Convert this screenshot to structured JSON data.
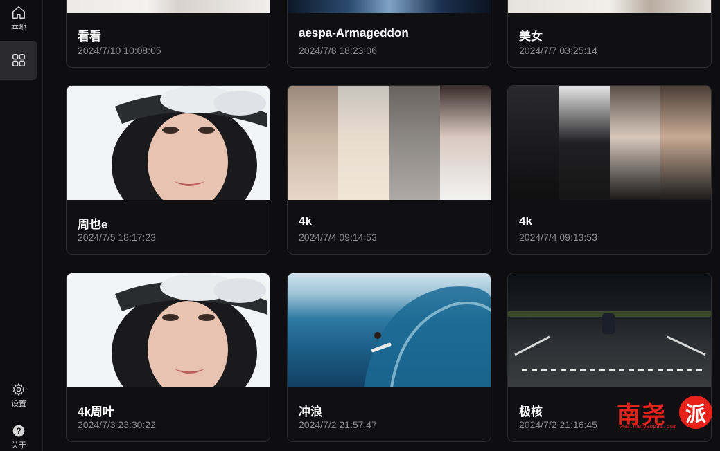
{
  "sidebar": {
    "items": [
      {
        "label": "本地",
        "icon": "home-icon"
      },
      {
        "label": "",
        "icon": "grid-icon"
      },
      {
        "label": "设置",
        "icon": "gear-icon"
      },
      {
        "label": "关于",
        "icon": "help-icon"
      }
    ]
  },
  "videos": [
    {
      "title": "看看",
      "date": "2024/7/10 10:08:05"
    },
    {
      "title": "aespa-Armageddon",
      "date": "2024/7/8 18:23:06"
    },
    {
      "title": "美女",
      "date": "2024/7/7 03:25:14"
    },
    {
      "title": "周也e",
      "date": "2024/7/5 18:17:23"
    },
    {
      "title": "4k",
      "date": "2024/7/4 09:14:53"
    },
    {
      "title": "4k",
      "date": "2024/7/4 09:13:53"
    },
    {
      "title": "4k周叶",
      "date": "2024/7/3 23:30:22"
    },
    {
      "title": "冲浪",
      "date": "2024/7/2 21:57:47"
    },
    {
      "title": "极核",
      "date": "2024/7/2 21:16:45"
    }
  ],
  "watermark": {
    "text": "南尧",
    "circle": "派",
    "url": "www.nanyaopai.com"
  },
  "colors": {
    "background": "#0e0e10",
    "card_border": "#2c2c31",
    "date_text": "#8c8c92",
    "active_nav": "#2a2a2e",
    "watermark": "#e8221b"
  }
}
